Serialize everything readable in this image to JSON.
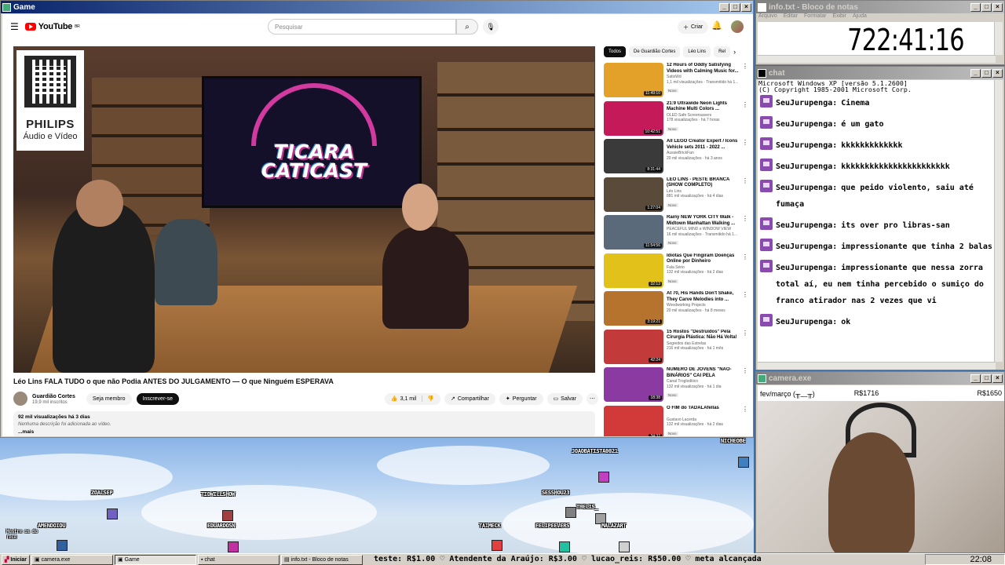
{
  "game_window": {
    "title": "Game"
  },
  "youtube": {
    "search_placeholder": "Pesquisar",
    "create_label": "Criar",
    "video_title": "Léo Lins FALA TUDO o que não Podia ANTES DO JULGAMENTO — O que Ninguém ESPERAVA",
    "channel_name": "Guardião Cortes",
    "channel_subs": "19,9 mil inscritos",
    "member_label": "Seja membro",
    "subscribe_label": "Inscrever-se",
    "likes": "3,1 mil",
    "share_label": "Compartilhar",
    "ask_label": "Perguntar",
    "save_label": "Salvar",
    "desc_stats": "92 mil visualizações  há 3 dias",
    "desc_text": "Nenhuma descrição foi adicionada ao vídeo.",
    "desc_more": "...mais",
    "overlay_brand": "PHILIPS",
    "overlay_sub": "Áudio e Vídeo",
    "screen_text": "TICARA\nCATICAST",
    "chips": [
      "Todos",
      "De Guardião Cortes",
      "Léo Lins",
      "Rel"
    ],
    "recs": [
      {
        "title": "12 Hours of Oddly Satisfying Videos with Calming Music for...",
        "channel": "SatisWd",
        "meta": "1,1 mil visualizações · Transmitido há 1...",
        "dur": "11:49:10",
        "badge": "Novo",
        "color": "#e4a12a"
      },
      {
        "title": "21:9 Ultrawide Neon Lights Machine Multi Colors ...",
        "channel": "OLED Safe Screensavers",
        "meta": "178 visualizações · há 7 horas",
        "dur": "10:42:51",
        "badge": "Novo",
        "color": "#c41a5a"
      },
      {
        "title": "All LEGO Creator Expert / Icons Vehicle sets 2011 - 2022 ...",
        "channel": "AussieBrickFan",
        "meta": "20 mil visualizações · há 3 anos",
        "dur": "8:31:44",
        "badge": "",
        "color": "#3a3a3a"
      },
      {
        "title": "LÉO LINS - PESTE BRANCA (SHOW COMPLETO)",
        "channel": "Léo Lins",
        "meta": "881 mil visualizações · há 4 dias",
        "dur": "1:27:04",
        "badge": "Novo",
        "color": "#5a4a3a"
      },
      {
        "title": "Rainy NEW YORK CITY Walk - Midtown Manhattan Walking ...",
        "channel": "PEACEFUL MIND e WINDOW VIEW",
        "meta": "16 mil visualizações · Transmitido há 1...",
        "dur": "11:54:56",
        "badge": "Novo",
        "color": "#5a6a7a"
      },
      {
        "title": "Idiotas Que Fingiram Doenças Online por Dinheiro",
        "channel": "Fala Sério",
        "meta": "132 mil visualizações · há 2 dias",
        "dur": "32:13",
        "badge": "Novo",
        "color": "#e2c21a"
      },
      {
        "title": "At 70, His Hands Don't Shake, They Carve Melodies into ...",
        "channel": "Woodworking Projects",
        "meta": "20 mil visualizações · há 8 meses",
        "dur": "3:19:21",
        "badge": "",
        "color": "#b5732e"
      },
      {
        "title": "15 Rostos \"Destruídos\" Pela Cirurgia Plástica: Não Há Volta!",
        "channel": "Segredos das Estrelas",
        "meta": "216 mil visualizações · há 1 mês",
        "dur": "42:24",
        "badge": "",
        "color": "#c23a3a"
      },
      {
        "title": "NÚMERO DE JOVENS \"NÃO-BINÁRIOS\" CAI PELA METADE...",
        "channel": "Canal Trogloditico",
        "meta": "132 mil visualizações · há 1 dia",
        "dur": "18:38",
        "badge": "Novo",
        "color": "#8a3aa0"
      },
      {
        "title": "O FIM do TADALAfellas",
        "channel": "Gustavo Lacerda",
        "meta": "132 mil visualizações · há 2 dias",
        "dur": "34:32",
        "badge": "Novo",
        "color": "#d23a3a"
      }
    ]
  },
  "game": {
    "players": [
      {
        "name": "JOAOBATISTA0021",
        "color": "#c040c0"
      },
      {
        "name": "ZOALSEP",
        "color": "#7060c0"
      },
      {
        "name": "TIOWILLSHOW",
        "color": "#a04040"
      },
      {
        "name": "SESSHOU23",
        "color": "#808080"
      },
      {
        "name": "THELIS_",
        "color": "#a0a0a0"
      },
      {
        "name": "AMENDOIOU",
        "color": "#3060a0"
      },
      {
        "name": "EDUARDOSN",
        "color": "#c030a0"
      },
      {
        "name": "TAIMECK",
        "color": "#e04040"
      },
      {
        "name": "FELIPEEVERS",
        "color": "#20c0a0"
      },
      {
        "name": "MALAZART",
        "color": "#d0d0d0"
      },
      {
        "name": "NICHEOBE",
        "color": "#4080c0"
      }
    ],
    "corner_label": "Mostre os do\nrece"
  },
  "notepad": {
    "title": "info.txt - Bloco de notas",
    "menu": [
      "Arquivo",
      "Editar",
      "Formatar",
      "Exibir",
      "Ajuda"
    ],
    "content": "722:41:16"
  },
  "chat": {
    "title": "chat",
    "system_lines": [
      "Microsoft Windows XP [versão 5.1.2600]",
      "(C) Copyright 1985-2001 Microsoft Corp."
    ],
    "messages": [
      {
        "user": "SeuJurupenga:",
        "text": "Cinema"
      },
      {
        "user": "SeuJurupenga:",
        "text": "é um gato"
      },
      {
        "user": "SeuJurupenga:",
        "text": "kkkkkkkkkkkkk"
      },
      {
        "user": "SeuJurupenga:",
        "text": "kkkkkkkkkkkkkkkkkkkkkkk"
      },
      {
        "user": "SeuJurupenga:",
        "text": "que peido violento, saiu até fumaça"
      },
      {
        "user": "SeuJurupenga:",
        "text": "its over pro libras-san"
      },
      {
        "user": "SeuJurupenga:",
        "text": "impressionante que tinha 2 balas"
      },
      {
        "user": "SeuJurupenga:",
        "text": "impressionante que nessa zorra total aí, eu nem tinha percebido o sumiço do franco atirador nas 2 vezes que vi"
      },
      {
        "user": "SeuJurupenga:",
        "text": "ok"
      }
    ]
  },
  "camera": {
    "title": "camera.exe",
    "header_left": "fev/março (╥﹏╥)",
    "value1": "R$1716",
    "value2": "R$1650"
  },
  "taskbar": {
    "start": "Iniciar",
    "buttons": [
      "camera.exe",
      "Game",
      "chat",
      "info.txt - Bloco de notas"
    ],
    "ticker": "teste: R$1.00  ♡ Atendente da Araújo: R$3.00  ♡ lucao_reis: R$50.00  ♡ meta alcançada",
    "clock": "22:08"
  }
}
